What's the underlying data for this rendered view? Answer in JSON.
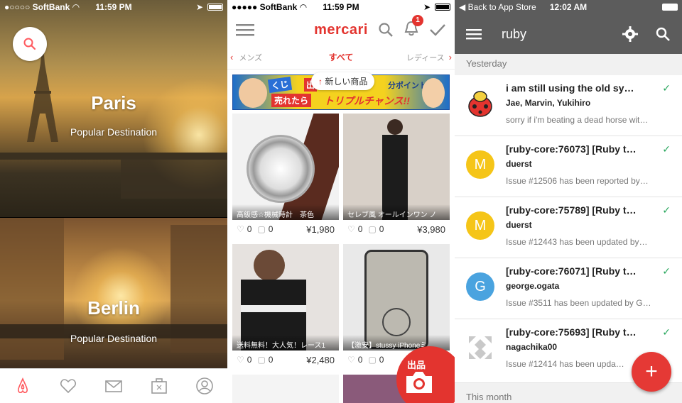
{
  "airbnb": {
    "status": {
      "carrier": "●○○○○ SoftBank",
      "time": "11:59 PM"
    },
    "destinations": [
      {
        "city": "Paris",
        "subtitle": "Popular Destination"
      },
      {
        "city": "Berlin",
        "subtitle": "Popular Destination"
      }
    ],
    "tabs": [
      "home-icon",
      "heart-icon",
      "mail-icon",
      "suitcase-icon",
      "profile-icon"
    ]
  },
  "mercari": {
    "status": {
      "carrier": "●●●●● SoftBank",
      "time": "11:59 PM"
    },
    "logo": "mercari",
    "notification_count": "1",
    "categories": {
      "left": "メンズ",
      "center": "すべて",
      "right": "レディース"
    },
    "banner": {
      "a": "くじ",
      "b": "出",
      "c": "分ポイント",
      "d": "売れたら",
      "e": "トリプルチャンス!!"
    },
    "new_items_label": "新しい商品",
    "listings": [
      {
        "caption": "高級感☆機械時計　茶色",
        "likes": "0",
        "comments": "0",
        "price": "¥1,980"
      },
      {
        "caption": "セレブ風 オールインワン ノ",
        "likes": "0",
        "comments": "0",
        "price": "¥3,980"
      },
      {
        "caption": "送料無料！大人気！レース1",
        "likes": "0",
        "comments": "0",
        "price": "¥2,480"
      },
      {
        "caption": "【激安】stussy iPhoneミ",
        "likes": "0",
        "comments": "0",
        "price": ""
      }
    ],
    "sell_label": "出品"
  },
  "inbox": {
    "status": {
      "back": "◀ Back to App Store",
      "time": "12:02 AM"
    },
    "title": "ruby",
    "sections": {
      "yesterday": "Yesterday",
      "month": "This month"
    },
    "mails": [
      {
        "avatar": "",
        "avatar_color": "#ffffff",
        "subject": "i am still using the old sy…",
        "from": "Jae, Marvin, Yukihiro",
        "snippet": "sorry if i'm beating a dead horse wit…"
      },
      {
        "avatar": "M",
        "avatar_color": "#f5c518",
        "subject": "[ruby-core:76073] [Ruby t…",
        "from": "duerst",
        "snippet": "Issue #12506 has been reported by…"
      },
      {
        "avatar": "M",
        "avatar_color": "#f5c518",
        "subject": "[ruby-core:75789] [Ruby t…",
        "from": "duerst",
        "snippet": "Issue #12443 has been updated by…"
      },
      {
        "avatar": "G",
        "avatar_color": "#4aa3df",
        "subject": "[ruby-core:76071] [Ruby t…",
        "from": "george.ogata",
        "snippet": "Issue #3511 has been updated by G…"
      },
      {
        "avatar": "",
        "avatar_color": "#ffffff",
        "subject": "[ruby-core:75693] [Ruby t…",
        "from": "nagachika00",
        "snippet": "Issue #12414 has been upda…"
      }
    ],
    "check": "✓",
    "compose": "+"
  }
}
